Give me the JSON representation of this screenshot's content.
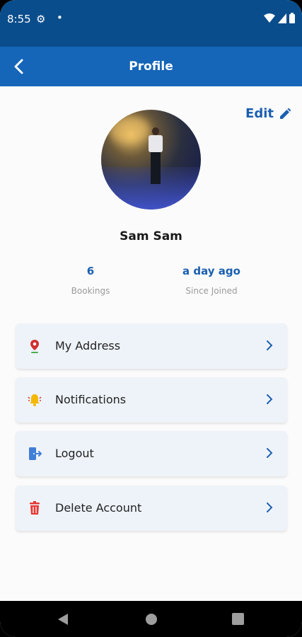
{
  "status_bar": {
    "time": "8:55",
    "dot": "•"
  },
  "app_bar": {
    "title": "Profile"
  },
  "profile": {
    "edit_label": "Edit",
    "name": "Sam Sam",
    "stats": [
      {
        "value": "6",
        "label": "Bookings"
      },
      {
        "value": "a day ago",
        "label": "Since Joined"
      }
    ]
  },
  "menu": [
    {
      "label": "My Address",
      "icon": "location-pin-icon",
      "color": "#d32f2f"
    },
    {
      "label": "Notifications",
      "icon": "bell-icon",
      "color": "#f5b800"
    },
    {
      "label": "Logout",
      "icon": "logout-icon",
      "color": "#3f7fd6"
    },
    {
      "label": "Delete Account",
      "icon": "trash-icon",
      "color": "#e53935"
    }
  ],
  "colors": {
    "status_bar": "#0a4d8c",
    "app_bar": "#1565b8",
    "accent": "#1b5fb0",
    "card": "#eef3f9"
  }
}
